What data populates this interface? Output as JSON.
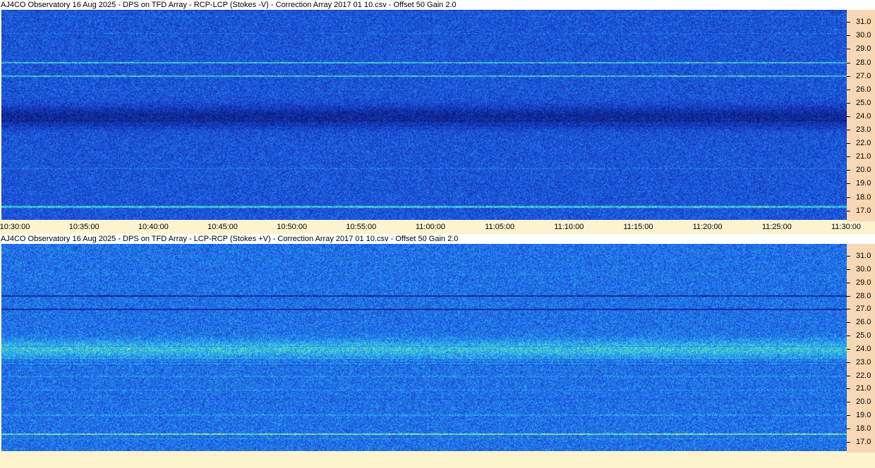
{
  "panel_top": {
    "title": "AJ4CO Observatory 16 Aug 2025  -  DPS on TFD Array  -  RCP-LCP (Stokes -V)  -  Correction Array 2017 01 10.csv  -  Offset 50  Gain 2.0"
  },
  "panel_bottom": {
    "title": "AJ4CO Observatory 16 Aug 2025  -  DPS on TFD Array  -  LCP-RCP (Stokes +V)  -  Correction Array 2017 01 10.csv  -  Offset 50  Gain 2.0"
  },
  "colors": {
    "background": "#fdf3cf",
    "axis_panel": "#f7d7b4",
    "spectrogram_base": "#1f4fd8"
  },
  "chart_data": [
    {
      "type": "heatmap",
      "title": "AJ4CO Observatory 16 Aug 2025  -  DPS on TFD Array  -  RCP-LCP (Stokes -V)  -  Correction Array 2017 01 10.csv  -  Offset 50  Gain 2.0",
      "x_ticks": [
        "10:30:00",
        "10:35:00",
        "10:40:00",
        "10:45:00",
        "10:50:00",
        "10:55:00",
        "11:00:00",
        "11:05:00",
        "11:10:00",
        "11:15:00",
        "11:20:00",
        "11:25:00",
        "11:30:00"
      ],
      "y_ticks": [
        "31.0",
        "30.0",
        "29.0",
        "28.0",
        "27.0",
        "26.0",
        "25.0",
        "24.0",
        "23.0",
        "22.0",
        "21.0",
        "20.0",
        "19.0",
        "18.0",
        "17.0"
      ],
      "xlim": [
        "10:30:00",
        "11:30:00"
      ],
      "ylim": [
        16.3,
        31.9
      ],
      "colormap": "blue-cyan-yellow",
      "features": [
        {
          "freq": 24.0,
          "kind": "dark band"
        },
        {
          "freq": 27.0,
          "kind": "bright line"
        },
        {
          "freq": 28.0,
          "kind": "bright line"
        },
        {
          "freq": 17.3,
          "kind": "bright line"
        }
      ]
    },
    {
      "type": "heatmap",
      "title": "AJ4CO Observatory 16 Aug 2025  -  DPS on TFD Array  -  LCP-RCP (Stokes +V)  -  Correction Array 2017 01 10.csv  -  Offset 50  Gain 2.0",
      "x_ticks": [],
      "y_ticks": [
        "31.0",
        "30.0",
        "29.0",
        "28.0",
        "27.0",
        "26.0",
        "25.0",
        "24.0",
        "23.0",
        "22.0",
        "21.0",
        "20.0",
        "19.0",
        "18.0",
        "17.0"
      ],
      "xlim": [
        "10:30:00",
        "11:30:00"
      ],
      "ylim": [
        16.3,
        31.9
      ],
      "colormap": "blue-cyan-yellow",
      "features": [
        {
          "freq": 24.0,
          "kind": "bright band"
        },
        {
          "freq": 27.0,
          "kind": "dark line"
        },
        {
          "freq": 28.0,
          "kind": "dark line"
        },
        {
          "freq": 17.6,
          "kind": "bright line"
        }
      ]
    }
  ]
}
